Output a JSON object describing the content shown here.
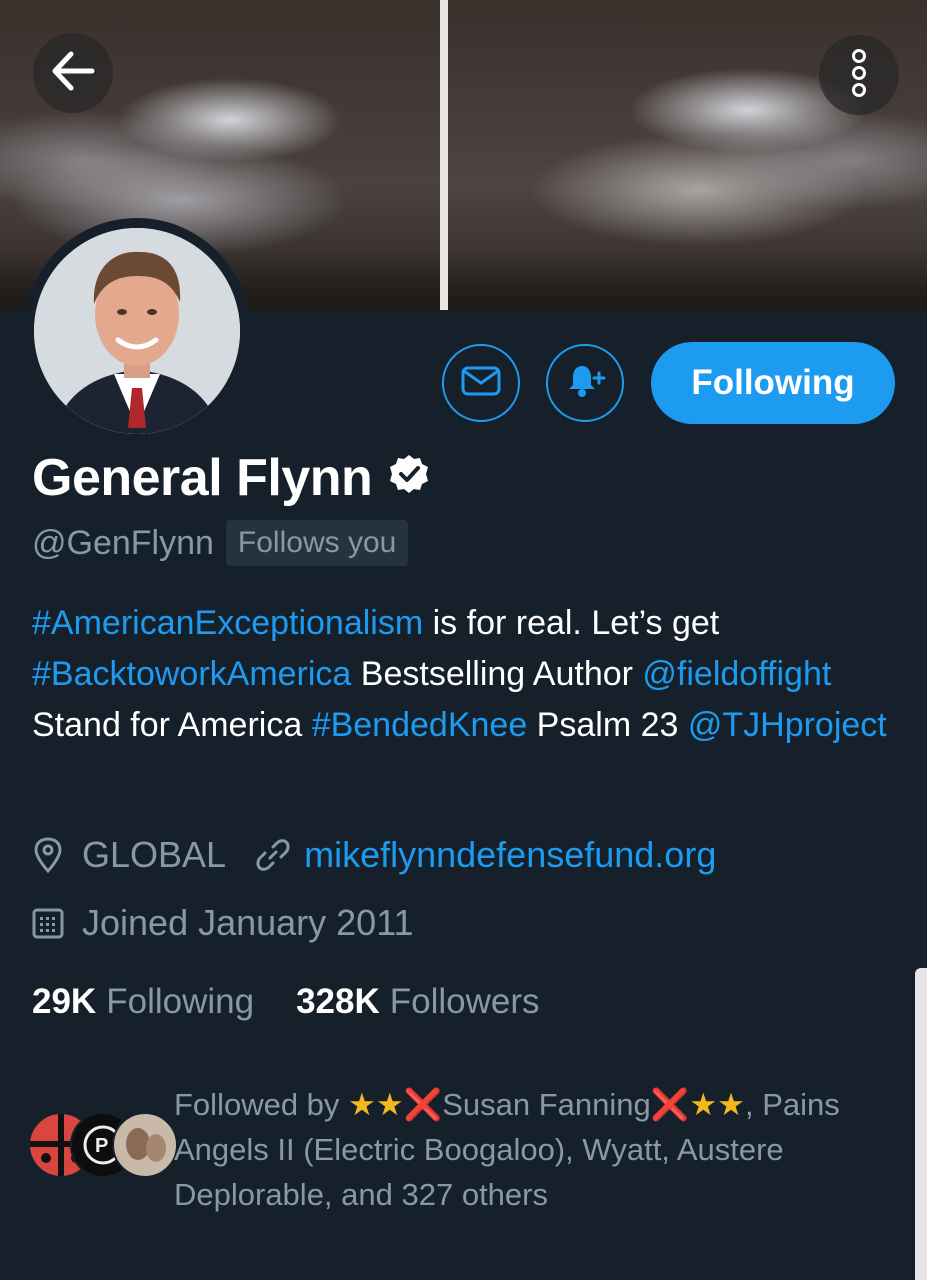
{
  "header": {
    "back_icon": "arrow-left-icon",
    "more_icon": "more-vertical-icon"
  },
  "actions": {
    "message_icon": "envelope-icon",
    "notify_icon": "bell-plus-icon",
    "following_label": "Following",
    "accent_color": "#1d9bf0"
  },
  "profile": {
    "name": "General Flynn",
    "handle": "@GenFlynn",
    "follows_you": "Follows you",
    "verified": true,
    "bio": {
      "p1": "#AmericanExceptionalism",
      "p2": " is for real. Let’s get ",
      "p3": "#BacktoworkAmerica",
      "p4": " Bestselling Author ",
      "p5": "@fieldoffight",
      "p6": " Stand for America ",
      "p7": "#BendedKnee",
      "p8": " Psalm 23 ",
      "p9": "@TJHproject"
    },
    "location": "GLOBAL",
    "website": "mikeflynndefensefund.org",
    "joined": "Joined January 2011"
  },
  "stats": {
    "following_count": "29K",
    "following_label": "Following",
    "followers_count": "328K",
    "followers_label": "Followers"
  },
  "followed_by": {
    "prefix": "Followed by ",
    "name1_pre": "★★",
    "name1_x1": "❌",
    "name1_core": "Susan Fanning",
    "name1_x2": "❌",
    "name1_post": "★★",
    "rest": ", Pains Angels II (Electric Boogaloo), Wyatt, Austere Deplorable, and 327 others"
  }
}
